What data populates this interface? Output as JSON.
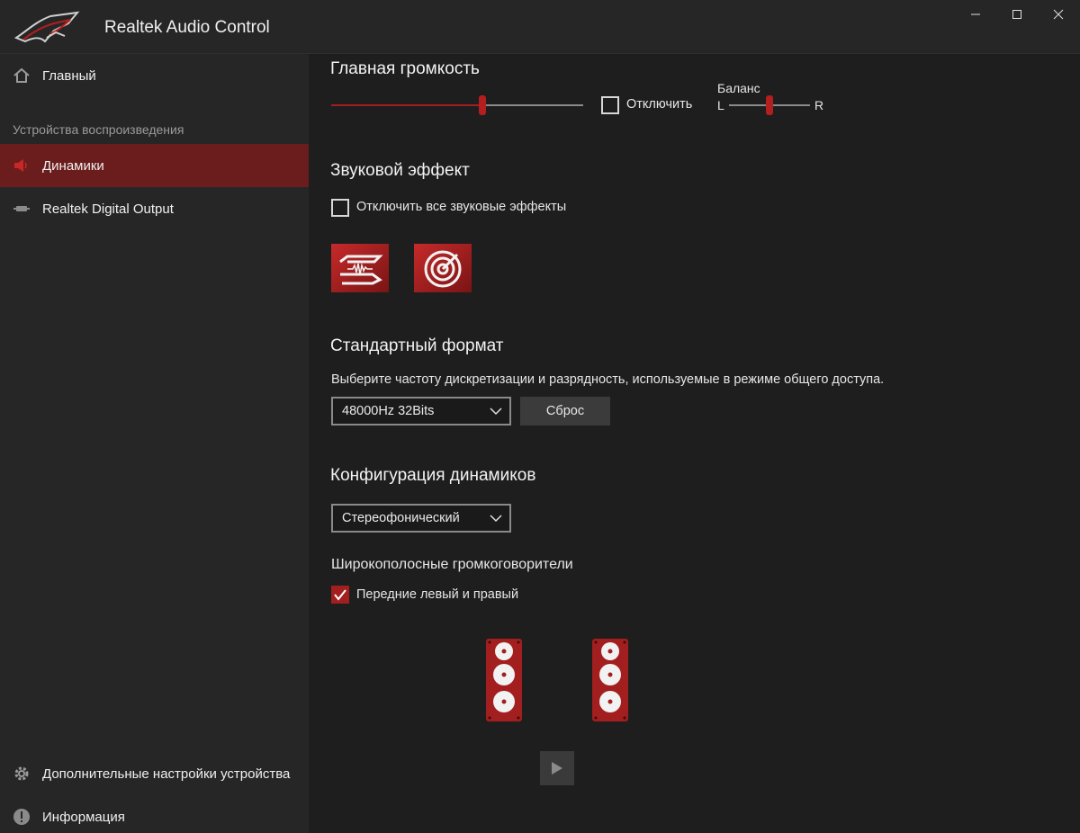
{
  "window": {
    "title": "Realtek Audio Control"
  },
  "sidebar": {
    "home_label": "Главный",
    "section_header": "Устройства воспроизведения",
    "devices": [
      {
        "label": "Динамики",
        "icon": "speaker-icon",
        "active": true
      },
      {
        "label": "Realtek Digital Output",
        "icon": "digital-output-icon",
        "active": false
      }
    ],
    "advanced_label": "Дополнительные настройки устройства",
    "info_label": "Информация"
  },
  "main": {
    "volume": {
      "title": "Главная громкость",
      "level": 0.6,
      "mute_label": "Отключить",
      "mute_checked": false,
      "balance_label": "Баланс",
      "balance_left": "L",
      "balance_right": "R",
      "balance_value": 0.5
    },
    "effects": {
      "title": "Звуковой эффект",
      "disable_all_label": "Отключить все звуковые эффекты",
      "disable_all_checked": false,
      "tiles": [
        "sonic-studio-icon",
        "sonic-radar-icon"
      ]
    },
    "format": {
      "title": "Стандартный формат",
      "description": "Выберите частоту дискретизации и разрядность, используемые в режиме общего доступа.",
      "selected": "48000Hz 32Bits",
      "reset_label": "Сброс"
    },
    "speaker_config": {
      "title": "Конфигурация динамиков",
      "selected": "Стереофонический",
      "fullrange_title": "Широкополосные громкоговорители",
      "front_label": "Передние левый и правый",
      "front_checked": true
    }
  },
  "colors": {
    "accent": "#a31e1e",
    "sidebar_bg": "#262626",
    "main_bg": "#1e1e1e",
    "active_item": "#6b1c1c"
  }
}
